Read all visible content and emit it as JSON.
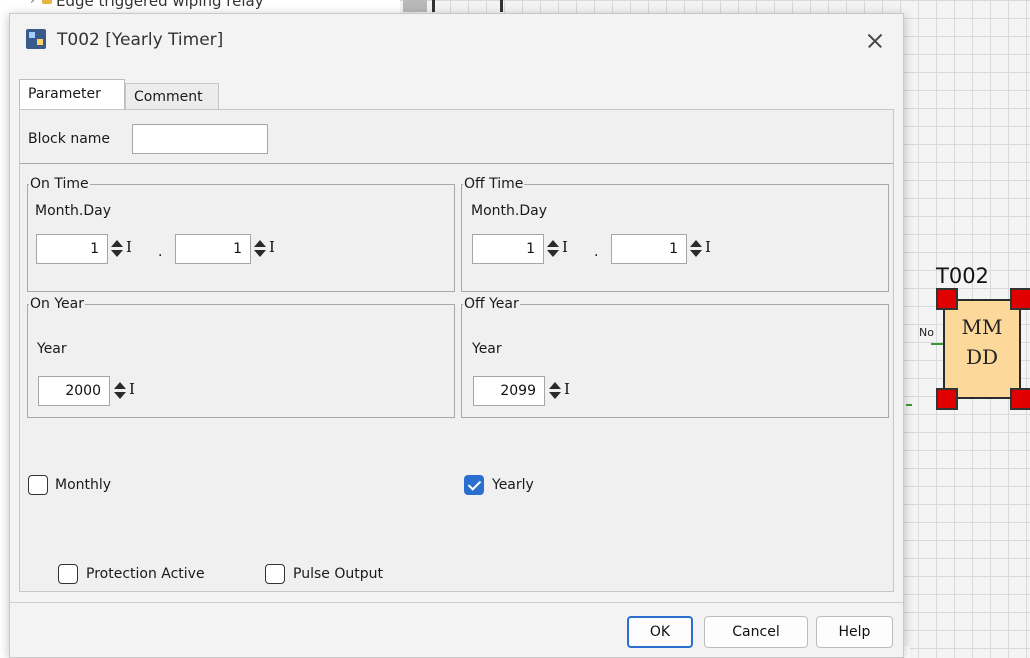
{
  "background": {
    "tree_item_text": "Edge triggered wiping relay",
    "block": {
      "name": "T002",
      "line1": "MM",
      "line2": "DD",
      "pin_label": "No"
    }
  },
  "dialog": {
    "title": "T002 [Yearly Timer]",
    "tabs": [
      {
        "label": "Parameter",
        "active": true
      },
      {
        "label": "Comment",
        "active": false
      }
    ],
    "block_name": {
      "label": "Block name",
      "value": ""
    },
    "on_time": {
      "legend": "On Time",
      "sublabel": "Month.Day",
      "month": "1",
      "day": "1",
      "separator": "."
    },
    "off_time": {
      "legend": "Off Time",
      "sublabel": "Month.Day",
      "month": "1",
      "day": "1",
      "separator": "."
    },
    "on_year": {
      "legend": "On Year",
      "sublabel": "Year",
      "value": "2000"
    },
    "off_year": {
      "legend": "Off Year",
      "sublabel": "Year",
      "value": "2099"
    },
    "ibutton_label": "I",
    "monthly": {
      "label": "Monthly",
      "checked": false
    },
    "yearly": {
      "label": "Yearly",
      "checked": true
    },
    "protection_active": {
      "label": "Protection Active",
      "checked": false
    },
    "pulse_output": {
      "label": "Pulse Output",
      "checked": false
    },
    "buttons": {
      "ok": "OK",
      "cancel": "Cancel",
      "help": "Help"
    }
  },
  "colors": {
    "accent": "#2a6fcf",
    "block_fill": "#fcd99a",
    "handle": "#e00000"
  }
}
